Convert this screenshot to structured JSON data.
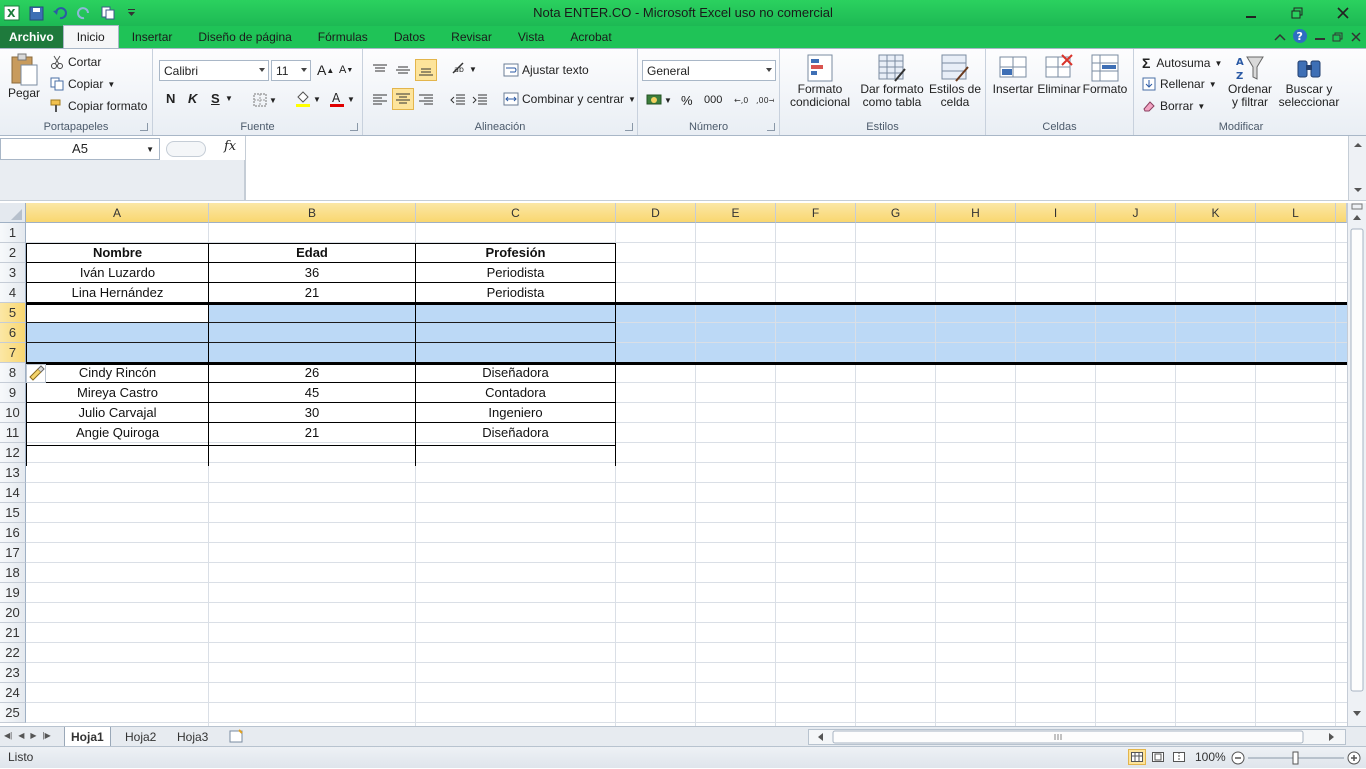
{
  "window": {
    "title": "Nota ENTER.CO  -  Microsoft Excel uso no comercial"
  },
  "tabs": [
    "Archivo",
    "Inicio",
    "Insertar",
    "Diseño de página",
    "Fórmulas",
    "Datos",
    "Revisar",
    "Vista",
    "Acrobat"
  ],
  "ribbon": {
    "clipboard": {
      "paste": "Pegar",
      "cut": "Cortar",
      "copy": "Copiar",
      "format_painter": "Copiar formato",
      "label": "Portapapeles"
    },
    "font": {
      "name": "Calibri",
      "size": "11",
      "label": "Fuente",
      "bold": "N",
      "italic": "K",
      "underline": "S"
    },
    "alignment": {
      "wrap": "Ajustar texto",
      "merge": "Combinar y centrar",
      "label": "Alineación"
    },
    "number": {
      "format": "General",
      "percent": "%",
      "thousands": "000",
      "label": "Número"
    },
    "styles": {
      "conditional": "Formato condicional",
      "table": "Dar formato como tabla",
      "cell_styles": "Estilos de celda",
      "label": "Estilos"
    },
    "cells": {
      "insert": "Insertar",
      "delete": "Eliminar",
      "format": "Formato",
      "label": "Celdas"
    },
    "editing": {
      "autosum": "Autosuma",
      "fill": "Rellenar",
      "clear": "Borrar",
      "sort": "Ordenar y filtrar",
      "find": "Buscar y seleccionar",
      "label": "Modificar"
    }
  },
  "formula_bar": {
    "name_box": "A5",
    "fx": "fx",
    "value": ""
  },
  "columns": [
    "A",
    "B",
    "C",
    "D",
    "E",
    "F",
    "G",
    "H",
    "I",
    "J",
    "K",
    "L"
  ],
  "rows": [
    "1",
    "2",
    "3",
    "4",
    "5",
    "6",
    "7",
    "8",
    "9",
    "10",
    "11",
    "12",
    "13",
    "14",
    "15",
    "16",
    "17",
    "18",
    "19",
    "20",
    "21",
    "22",
    "23",
    "24",
    "25"
  ],
  "table": {
    "headers": [
      "Nombre",
      "Edad",
      "Profesión"
    ],
    "rows": [
      [
        "Iván Luzardo",
        "36",
        "Periodista"
      ],
      [
        "Lina Hernández",
        "21",
        "Periodista"
      ],
      [
        "",
        "",
        ""
      ],
      [
        "",
        "",
        ""
      ],
      [
        "",
        "",
        ""
      ],
      [
        "Cindy Rincón",
        "26",
        "Diseñadora"
      ],
      [
        "Mireya Castro",
        "45",
        "Contadora"
      ],
      [
        "Julio Carvajal",
        "30",
        "Ingeniero"
      ],
      [
        "Angie Quiroga",
        "21",
        "Diseñadora"
      ]
    ]
  },
  "sheets": [
    "Hoja1",
    "Hoja2",
    "Hoja3"
  ],
  "status": {
    "ready": "Listo",
    "zoom": "100%"
  }
}
